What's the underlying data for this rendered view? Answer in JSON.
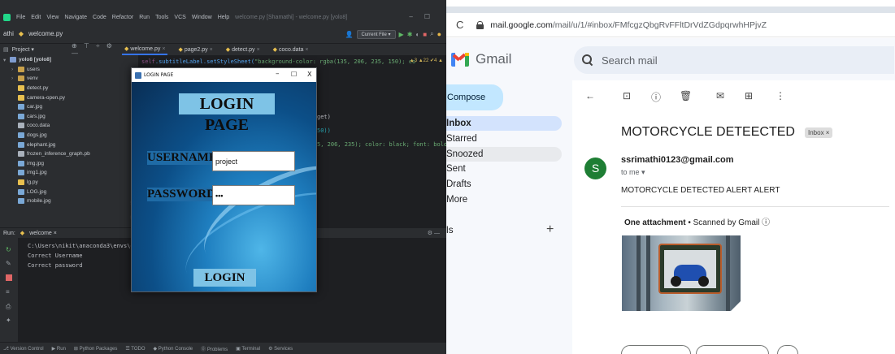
{
  "ide": {
    "menu": [
      "File",
      "Edit",
      "View",
      "Navigate",
      "Code",
      "Refactor",
      "Run",
      "Tools",
      "VCS",
      "Window",
      "Help"
    ],
    "window_title": "welcome.py [Shamathi] - welcome.py [yolo8]",
    "nav_project": "athi",
    "nav_file": "welcome.py",
    "run_config": "Current File ▾",
    "project_label": "Project ▾",
    "tree": [
      {
        "label": "yolo8 [yolo8]",
        "type": "root",
        "indent": 0,
        "chev": "▾"
      },
      {
        "label": "users",
        "type": "folder",
        "indent": 1,
        "chev": "›"
      },
      {
        "label": "venv",
        "type": "folder",
        "indent": 1,
        "chev": "›"
      },
      {
        "label": "detect.py",
        "type": "py",
        "indent": 1,
        "chev": ""
      },
      {
        "label": "camera-open.py",
        "type": "py",
        "indent": 1,
        "chev": ""
      },
      {
        "label": "car.jpg",
        "type": "img",
        "indent": 1,
        "chev": ""
      },
      {
        "label": "cars.jpg",
        "type": "img",
        "indent": 1,
        "chev": ""
      },
      {
        "label": "coco.data",
        "type": "data",
        "indent": 1,
        "chev": ""
      },
      {
        "label": "dogs.jpg",
        "type": "img",
        "indent": 1,
        "chev": ""
      },
      {
        "label": "elephant.jpg",
        "type": "img",
        "indent": 1,
        "chev": ""
      },
      {
        "label": "frozen_inference_graph.pb",
        "type": "data",
        "indent": 1,
        "chev": ""
      },
      {
        "label": "img.jpg",
        "type": "img",
        "indent": 1,
        "chev": ""
      },
      {
        "label": "img1.jpg",
        "type": "img",
        "indent": 1,
        "chev": ""
      },
      {
        "label": "lg.py",
        "type": "py",
        "indent": 1,
        "chev": ""
      },
      {
        "label": "LOG.jpg",
        "type": "img",
        "indent": 1,
        "chev": ""
      },
      {
        "label": "mobile.jpg",
        "type": "img",
        "indent": 1,
        "chev": ""
      }
    ],
    "tabs": [
      {
        "label": "welcome.py",
        "active": true
      },
      {
        "label": "page2.py",
        "active": false
      },
      {
        "label": "detect.py",
        "active": false
      },
      {
        "label": "coco.data",
        "active": false
      }
    ],
    "gutter": [
      "",
      "",
      "",
      "",
      "",
      "",
      "",
      "",
      "",
      "",
      "52",
      "53"
    ],
    "code": {
      "line1_self": "self",
      "line1_meth": ".subtitleLabel.setStyleSheet(",
      "line1_str": "\"background-color: rgba(135, 206, 235, 150); co",
      "line2": "get)",
      "line3": "50))",
      "line4": "5, 206, 235); color: black; font: bold 18"
    },
    "inspect": "▲3 ▲22 ✔4 ▲",
    "run_label": "welcome ×",
    "run_right": "⚙ —",
    "console": [
      "C:\\Users\\nikit\\anaconda3\\envs\\objec",
      "Correct Username",
      "Correct password"
    ],
    "status": [
      "Version Control",
      "Run",
      "Python Packages",
      "TODO",
      "Python Console",
      "Problems",
      "Terminal",
      "Services"
    ]
  },
  "login": {
    "window_title": "LOGIN PAGE",
    "heading": "LOGIN PAGE",
    "username_label": "USERNAME:",
    "password_label": "PASSWORD:",
    "username_value": "project",
    "password_value": "•••",
    "button": "LOGIN",
    "ctrl_min": "–",
    "ctrl_max": "☐",
    "ctrl_close": "X"
  },
  "browser": {
    "url_prefix": "mail.google.com",
    "url_rest": "/mail/u/1/#inbox/FMfcgzQbgRvFFltDrVdZGdpqrwhHPjvZ",
    "reload": "C"
  },
  "gmail": {
    "logo_text": "Gmail",
    "search_placeholder": "Search mail",
    "compose": "Compose",
    "nav": [
      {
        "label": "Inbox",
        "state": "active"
      },
      {
        "label": "Starred",
        "state": ""
      },
      {
        "label": "Snoozed",
        "state": "hover"
      },
      {
        "label": "Sent",
        "state": ""
      },
      {
        "label": "Drafts",
        "state": ""
      },
      {
        "label": "More",
        "state": ""
      }
    ],
    "labels_heading": "ls",
    "labels_plus": "+",
    "subject": "MOTORCYCLE DETEECTED",
    "inbox_chip": "Inbox ×",
    "avatar_letter": "S",
    "sender": "ssrimathi0123@gmail.com",
    "to_me": "to me ▾",
    "body": "MOTORCYCLE DETECTED ALERT ALERT",
    "attachment_count": "One attachment",
    "attachment_sep": " • ",
    "scanned": "Scanned by Gmail ⓘ",
    "colors": {
      "compose": "#c2e7ff",
      "active_nav": "#d3e3fd",
      "avatar": "#1e7e34"
    }
  }
}
